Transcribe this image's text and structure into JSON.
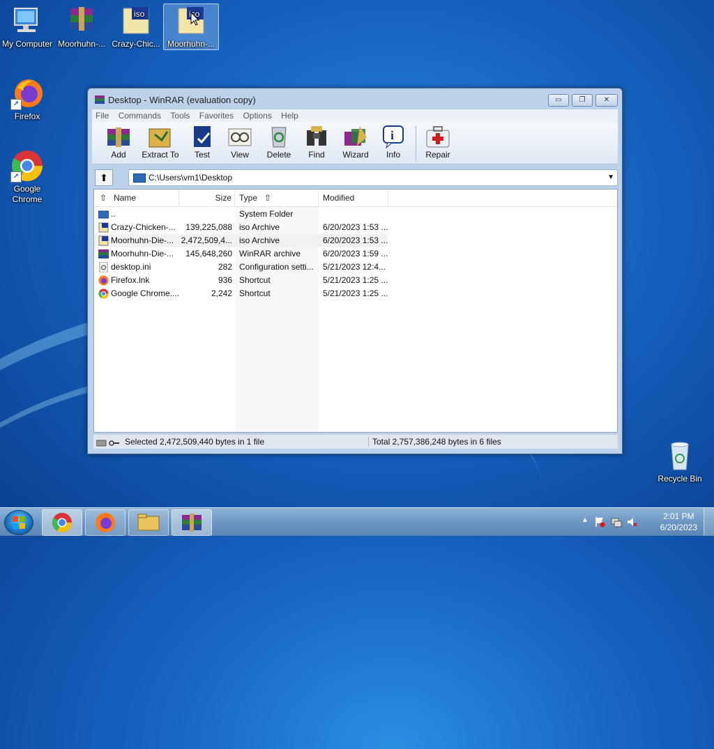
{
  "desktop": {
    "icons": [
      {
        "label": "My Computer",
        "icon": "computer-icon"
      },
      {
        "label": "Moorhuhn-...",
        "icon": "winrar-archive-icon"
      },
      {
        "label": "Crazy-Chic...",
        "icon": "iso-file-icon"
      },
      {
        "label": "Moorhuhn-...",
        "icon": "iso-file-icon"
      },
      {
        "label": "Firefox",
        "icon": "firefox-icon"
      },
      {
        "label": "Google\nChrome",
        "icon": "chrome-icon"
      },
      {
        "label": "Recycle Bin",
        "icon": "recycle-bin-icon"
      }
    ]
  },
  "window": {
    "title": "Desktop - WinRAR (evaluation copy)",
    "controls": {
      "minimize": "▭",
      "restore": "❐",
      "close": "✕"
    },
    "menu": [
      "File",
      "Commands",
      "Tools",
      "Favorites",
      "Options",
      "Help"
    ],
    "toolbar": [
      "Add",
      "Extract To",
      "Test",
      "View",
      "Delete",
      "Find",
      "Wizard",
      "Info",
      "Repair"
    ],
    "address": "C:\\Users\\vm1\\Desktop",
    "columns": {
      "name": "Name",
      "size": "Size",
      "type": "Type",
      "modified": "Modified"
    },
    "rows": [
      {
        "name": "..",
        "size": "",
        "type": "System Folder",
        "modified": "",
        "icon": "folder-up-icon"
      },
      {
        "name": "Crazy-Chicken-...",
        "size": "139,225,088",
        "type": "iso Archive",
        "modified": "6/20/2023 1:53 ...",
        "icon": "iso-file-icon"
      },
      {
        "name": "Moorhuhn-Die-...",
        "size": "2,472,509,4...",
        "type": "iso Archive",
        "modified": "6/20/2023 1:53 ...",
        "icon": "iso-file-icon"
      },
      {
        "name": "Moorhuhn-Die-...",
        "size": "145,648,260",
        "type": "WinRAR archive",
        "modified": "6/20/2023 1:59 ...",
        "icon": "winrar-archive-icon"
      },
      {
        "name": "desktop.ini",
        "size": "282",
        "type": "Configuration setti...",
        "modified": "5/21/2023 12:4...",
        "icon": "settings-file-icon"
      },
      {
        "name": "Firefox.lnk",
        "size": "936",
        "type": "Shortcut",
        "modified": "5/21/2023 1:25 ...",
        "icon": "firefox-icon"
      },
      {
        "name": "Google Chrome....",
        "size": "2,242",
        "type": "Shortcut",
        "modified": "5/21/2023 1:25 ...",
        "icon": "chrome-icon"
      }
    ],
    "status_left": "Selected 2,472,509,440 bytes in 1 file",
    "status_right": "Total 2,757,386,248 bytes in 6 files"
  },
  "taskbar": {
    "items": [
      "start-orb-icon",
      "chrome-icon",
      "firefox-icon",
      "file-explorer-icon",
      "winrar-icon"
    ],
    "time": "2:01 PM",
    "date": "6/20/2023"
  },
  "colors": {
    "accent": "#1866c4",
    "window_frame": "#bcd1ea"
  }
}
